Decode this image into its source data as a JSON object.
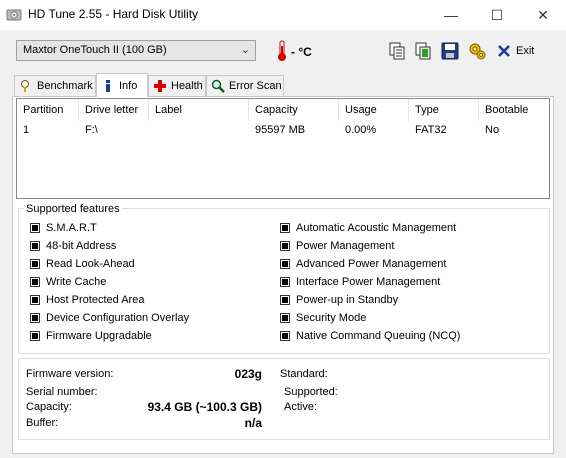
{
  "window": {
    "title": "HD Tune 2.55 - Hard Disk Utility",
    "minimize": "—",
    "maximize": "☐",
    "close": "✕"
  },
  "toolbar": {
    "drive": "Maxtor  OneTouch II (100 GB)",
    "temperature": "- °C",
    "icons": [
      "copy-icon",
      "copy-all-icon",
      "save-icon",
      "options-icon"
    ],
    "exit_label": "Exit"
  },
  "tabs": [
    {
      "label": "Benchmark",
      "icon": "benchmark-icon"
    },
    {
      "label": "Info",
      "icon": "info-icon",
      "active": true
    },
    {
      "label": "Health",
      "icon": "health-icon"
    },
    {
      "label": "Error Scan",
      "icon": "error-scan-icon"
    }
  ],
  "partitions": {
    "headers": [
      "Partition",
      "Drive letter",
      "Label",
      "Capacity",
      "Usage",
      "Type",
      "Bootable"
    ],
    "rows": [
      [
        "1",
        "F:\\",
        "",
        "95597 MB",
        "0.00%",
        "FAT32",
        "No"
      ]
    ]
  },
  "features": {
    "title": "Supported features",
    "left": [
      "S.M.A.R.T",
      "48-bit Address",
      "Read Look-Ahead",
      "Write Cache",
      "Host Protected Area",
      "Device Configuration Overlay",
      "Firmware Upgradable"
    ],
    "right": [
      "Automatic Acoustic Management",
      "Power Management",
      "Advanced Power Management",
      "Interface Power Management",
      "Power-up in Standby",
      "Security Mode",
      "Native Command Queuing (NCQ)"
    ]
  },
  "info": {
    "firmware_label": "Firmware version:",
    "firmware_value": "023g",
    "serial_label": "Serial number:",
    "serial_value": "",
    "capacity_label": "Capacity:",
    "capacity_value": "93.4 GB (~100.3 GB)",
    "buffer_label": "Buffer:",
    "buffer_value": "n/a",
    "standard_label": "Standard:",
    "supported_label": "Supported:",
    "active_label": "Active:"
  }
}
